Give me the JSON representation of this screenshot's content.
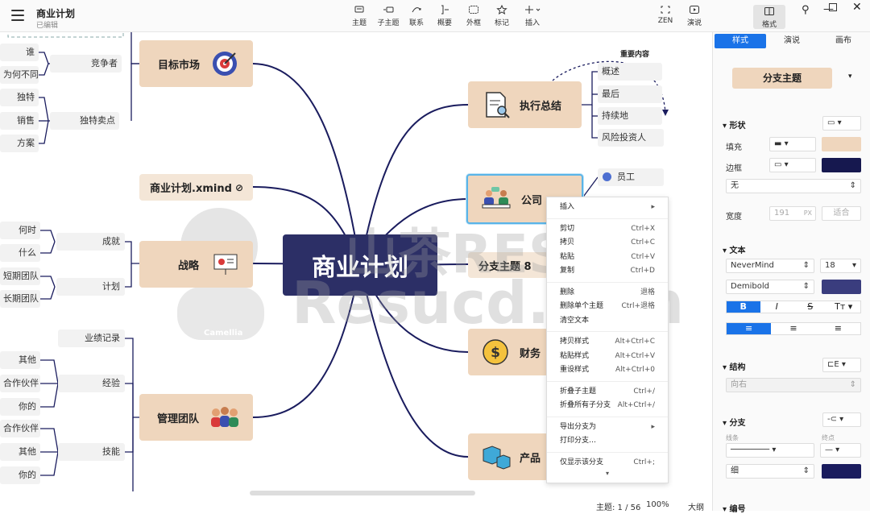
{
  "app": {
    "title": "商业计划",
    "subtitle": "已编辑"
  },
  "toolbar": [
    {
      "id": "topic",
      "label": "主题"
    },
    {
      "id": "subtopic",
      "label": "子主题"
    },
    {
      "id": "relation",
      "label": "联系"
    },
    {
      "id": "summary",
      "label": "概要"
    },
    {
      "id": "boundary",
      "label": "外框"
    },
    {
      "id": "marker",
      "label": "标记"
    },
    {
      "id": "insert",
      "label": "插入"
    },
    {
      "id": "zen",
      "label": "ZEN"
    },
    {
      "id": "present",
      "label": "演说"
    },
    {
      "id": "format",
      "label": "格式"
    }
  ],
  "mindmap": {
    "central": "商业计划",
    "left": {
      "market": {
        "label": "目标市场",
        "leaves": [
          "谁",
          "为何不同",
          "独特",
          "销售",
          "方案"
        ],
        "subs": [
          "竞争者",
          "独特卖点"
        ]
      },
      "file": {
        "label": "商业计划.xmind"
      },
      "strategy": {
        "label": "战略",
        "subs": [
          "成就",
          "计划"
        ],
        "leaves": [
          "何时",
          "什么",
          "短期团队",
          "长期团队"
        ]
      },
      "team": {
        "label": "管理团队",
        "subs": [
          "业绩记录",
          "经验",
          "技能"
        ],
        "leaves": [
          "其他",
          "合作伙伴",
          "你的",
          "合作伙伴",
          "其他",
          "你的"
        ]
      }
    },
    "right": {
      "exec": {
        "label": "执行总结",
        "leaves": [
          "概述",
          "最后",
          "持续地",
          "风险投资人"
        ],
        "callout": "重要内容"
      },
      "company": {
        "label": "公司",
        "leaves": [
          "员工"
        ]
      },
      "branch": {
        "label": "分支主题 8"
      },
      "finance": {
        "label": "财务"
      },
      "product": {
        "label": "产品"
      }
    }
  },
  "watermark": {
    "line1": "山茶RES",
    "line2": "Resucd.com",
    "avatar_label": "Camellia"
  },
  "context_menu": {
    "groups": [
      [
        {
          "label": "插入",
          "key": "▸"
        }
      ],
      [
        {
          "label": "剪切",
          "key": "Ctrl+X"
        },
        {
          "label": "拷贝",
          "key": "Ctrl+C"
        },
        {
          "label": "粘贴",
          "key": "Ctrl+V"
        },
        {
          "label": "复制",
          "key": "Ctrl+D"
        }
      ],
      [
        {
          "label": "删除",
          "key": "退格"
        },
        {
          "label": "删除单个主题",
          "key": "Ctrl+退格"
        },
        {
          "label": "清空文本",
          "key": ""
        }
      ],
      [
        {
          "label": "拷贝样式",
          "key": "Alt+Ctrl+C"
        },
        {
          "label": "粘贴样式",
          "key": "Alt+Ctrl+V"
        },
        {
          "label": "重设样式",
          "key": "Alt+Ctrl+0"
        }
      ],
      [
        {
          "label": "折叠子主题",
          "key": "Ctrl+/"
        },
        {
          "label": "折叠所有子分支",
          "key": "Alt+Ctrl+/"
        }
      ],
      [
        {
          "label": "导出分支为",
          "key": "▸"
        },
        {
          "label": "打印分支…",
          "key": ""
        }
      ],
      [
        {
          "label": "仅显示该分支",
          "key": "Ctrl+;"
        }
      ]
    ],
    "more": "▾"
  },
  "panel": {
    "tabs": [
      "样式",
      "演说",
      "画布"
    ],
    "style_name": "分支主题",
    "shape_section": "形状",
    "fill_label": "填充",
    "border_label": "边框",
    "border_style": "无",
    "width_label": "宽度",
    "width_value": "191",
    "width_unit": "PX",
    "width_fit": "适合",
    "text_section": "文本",
    "font": "NeverMind",
    "font_size": "18",
    "weight": "Demibold",
    "structure_section": "结构",
    "structure_value": "向右",
    "branch_section": "分支",
    "line_label": "线条",
    "end_label": "终点",
    "thickness": "细",
    "numbering_section": "编号",
    "colors": {
      "fill": "#efd6bd",
      "border": "#16184f",
      "text": "#3a3d7e",
      "branch": "#1a1c5e",
      "accent": "#1a73e8"
    }
  },
  "status": {
    "topics": "主题: 1 / 56",
    "zoom": "100%",
    "outline": "大纲"
  }
}
